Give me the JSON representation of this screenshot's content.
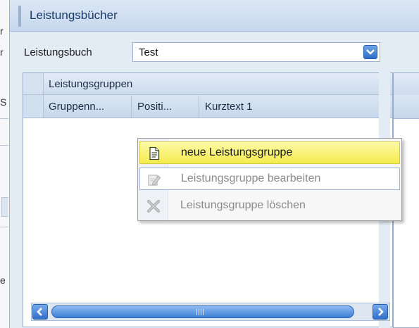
{
  "window": {
    "title": "Leistungsbücher"
  },
  "form": {
    "label": "Leistungsbuch",
    "selected_value": "Test"
  },
  "grid": {
    "group_header": "Leistungsgruppen",
    "columns": [
      "Gruppenn...",
      "Positi...",
      "Kurztext 1"
    ]
  },
  "context_menu": {
    "items": [
      {
        "label": "neue Leistungsgruppe",
        "icon": "new-document-icon",
        "enabled": true,
        "state": "hovered"
      },
      {
        "label": "Leistungsgruppe bearbeiten",
        "icon": "edit-icon",
        "enabled": false
      },
      {
        "label": "Leistungsgruppe löschen",
        "icon": "delete-x-icon",
        "enabled": false
      }
    ]
  },
  "left_edge_fragments": [
    "r",
    "r",
    "S",
    "e"
  ],
  "colors": {
    "title_text": "#173a6a",
    "highlight": "#f5ec4d",
    "scroll_accent": "#2f6fca",
    "disabled_text": "#8a8a8a"
  }
}
